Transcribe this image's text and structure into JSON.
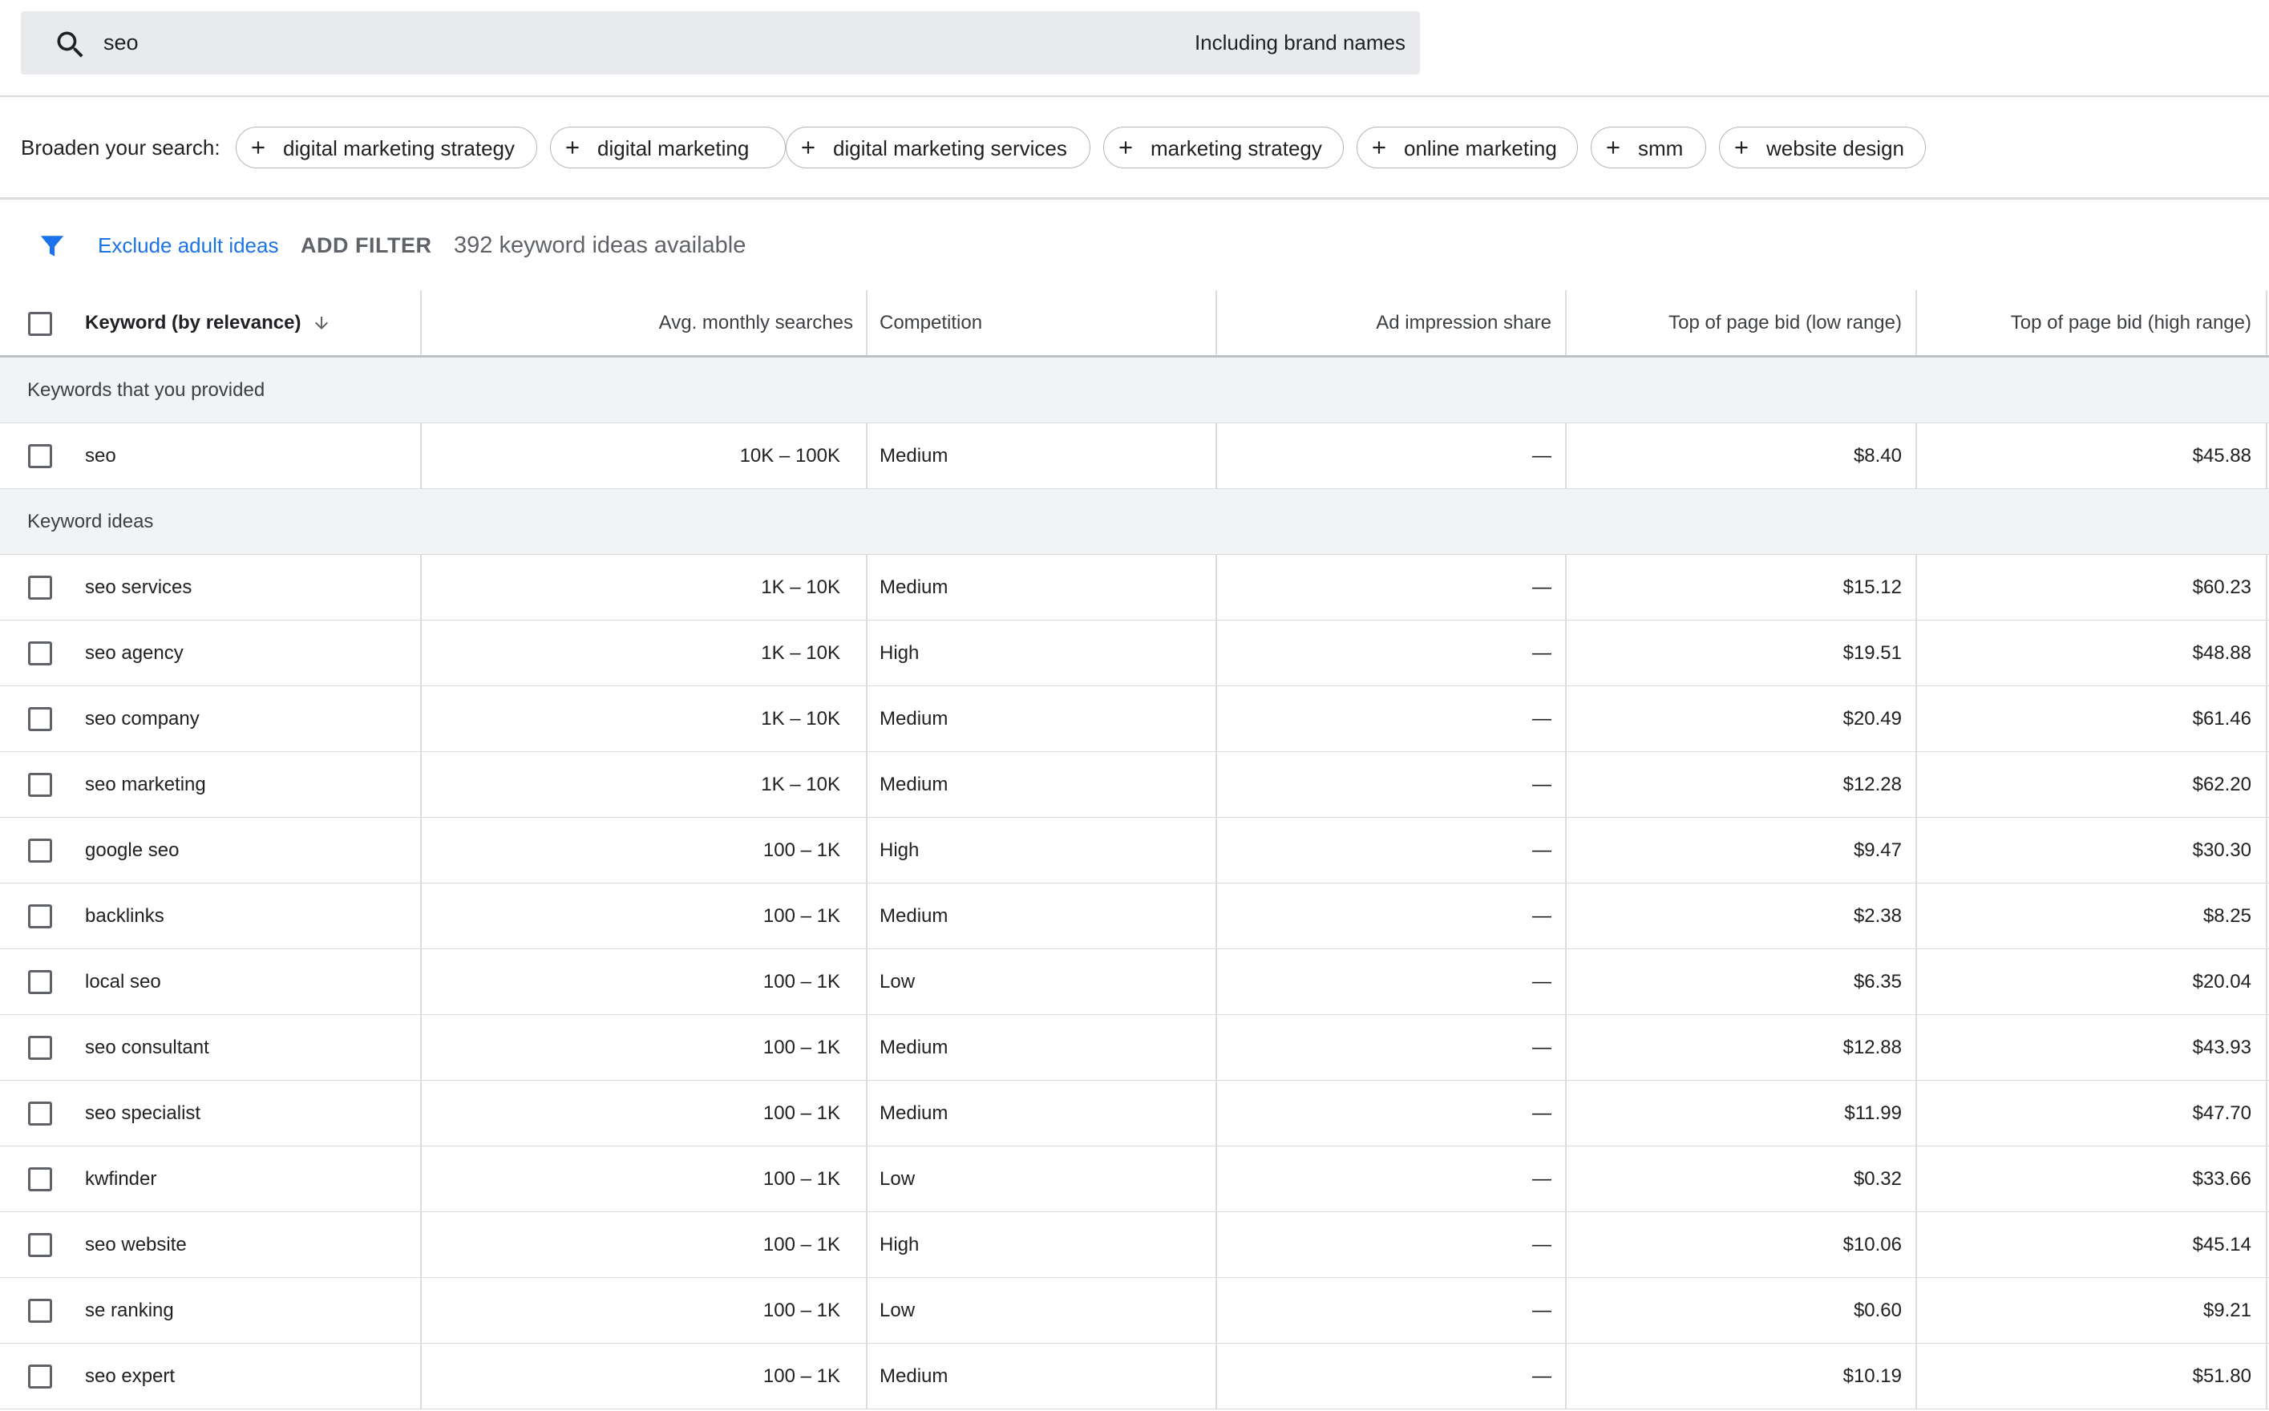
{
  "search": {
    "value": "seo",
    "brand_names_label": "Including brand names"
  },
  "broaden": {
    "label": "Broaden your search:",
    "chips": [
      "digital marketing strategy",
      "digital marketing",
      "digital marketing services",
      "marketing strategy",
      "online marketing",
      "smm",
      "website design"
    ]
  },
  "filters": {
    "exclude_adult": "Exclude adult ideas",
    "add_filter": "ADD FILTER",
    "count_text": "392 keyword ideas available"
  },
  "table": {
    "headers": {
      "keyword": "Keyword (by relevance)",
      "searches": "Avg. monthly searches",
      "competition": "Competition",
      "impression": "Ad impression share",
      "bid_low": "Top of page bid (low range)",
      "bid_high": "Top of page bid (high range)"
    },
    "provided_section": "Keywords that you provided",
    "provided": [
      {
        "keyword": "seo",
        "searches": "10K – 100K",
        "competition": "Medium",
        "impression": "—",
        "bid_low": "$8.40",
        "bid_high": "$45.88"
      }
    ],
    "ideas_section": "Keyword ideas",
    "ideas": [
      {
        "keyword": "seo services",
        "searches": "1K – 10K",
        "competition": "Medium",
        "impression": "—",
        "bid_low": "$15.12",
        "bid_high": "$60.23"
      },
      {
        "keyword": "seo agency",
        "searches": "1K – 10K",
        "competition": "High",
        "impression": "—",
        "bid_low": "$19.51",
        "bid_high": "$48.88"
      },
      {
        "keyword": "seo company",
        "searches": "1K – 10K",
        "competition": "Medium",
        "impression": "—",
        "bid_low": "$20.49",
        "bid_high": "$61.46"
      },
      {
        "keyword": "seo marketing",
        "searches": "1K – 10K",
        "competition": "Medium",
        "impression": "—",
        "bid_low": "$12.28",
        "bid_high": "$62.20"
      },
      {
        "keyword": "google seo",
        "searches": "100 – 1K",
        "competition": "High",
        "impression": "—",
        "bid_low": "$9.47",
        "bid_high": "$30.30"
      },
      {
        "keyword": "backlinks",
        "searches": "100 – 1K",
        "competition": "Medium",
        "impression": "—",
        "bid_low": "$2.38",
        "bid_high": "$8.25"
      },
      {
        "keyword": "local seo",
        "searches": "100 – 1K",
        "competition": "Low",
        "impression": "—",
        "bid_low": "$6.35",
        "bid_high": "$20.04"
      },
      {
        "keyword": "seo consultant",
        "searches": "100 – 1K",
        "competition": "Medium",
        "impression": "—",
        "bid_low": "$12.88",
        "bid_high": "$43.93"
      },
      {
        "keyword": "seo specialist",
        "searches": "100 – 1K",
        "competition": "Medium",
        "impression": "—",
        "bid_low": "$11.99",
        "bid_high": "$47.70"
      },
      {
        "keyword": "kwfinder",
        "searches": "100 – 1K",
        "competition": "Low",
        "impression": "—",
        "bid_low": "$0.32",
        "bid_high": "$33.66"
      },
      {
        "keyword": "seo website",
        "searches": "100 – 1K",
        "competition": "High",
        "impression": "—",
        "bid_low": "$10.06",
        "bid_high": "$45.14"
      },
      {
        "keyword": "se ranking",
        "searches": "100 – 1K",
        "competition": "Low",
        "impression": "—",
        "bid_low": "$0.60",
        "bid_high": "$9.21"
      },
      {
        "keyword": "seo expert",
        "searches": "100 – 1K",
        "competition": "Medium",
        "impression": "—",
        "bid_low": "$10.19",
        "bid_high": "$51.80"
      }
    ]
  },
  "colors": {
    "accent_blue": "#1a73e8",
    "search_bg": "#e8eaed",
    "section_bg": "#f1f3f4",
    "divider": "#dadce0"
  }
}
